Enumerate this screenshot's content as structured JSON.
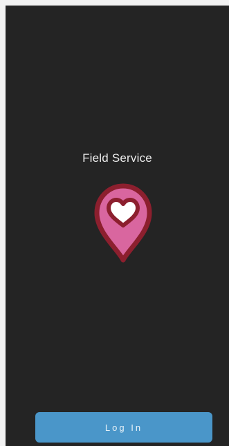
{
  "app": {
    "title": "Field Service",
    "logo_icon": "map-pin-heart-icon"
  },
  "actions": {
    "login_label": "Log In"
  },
  "colors": {
    "background": "#242424",
    "pin_fill": "#d9669f",
    "pin_outline": "#8c1f2e",
    "button": "#4a96c9"
  }
}
